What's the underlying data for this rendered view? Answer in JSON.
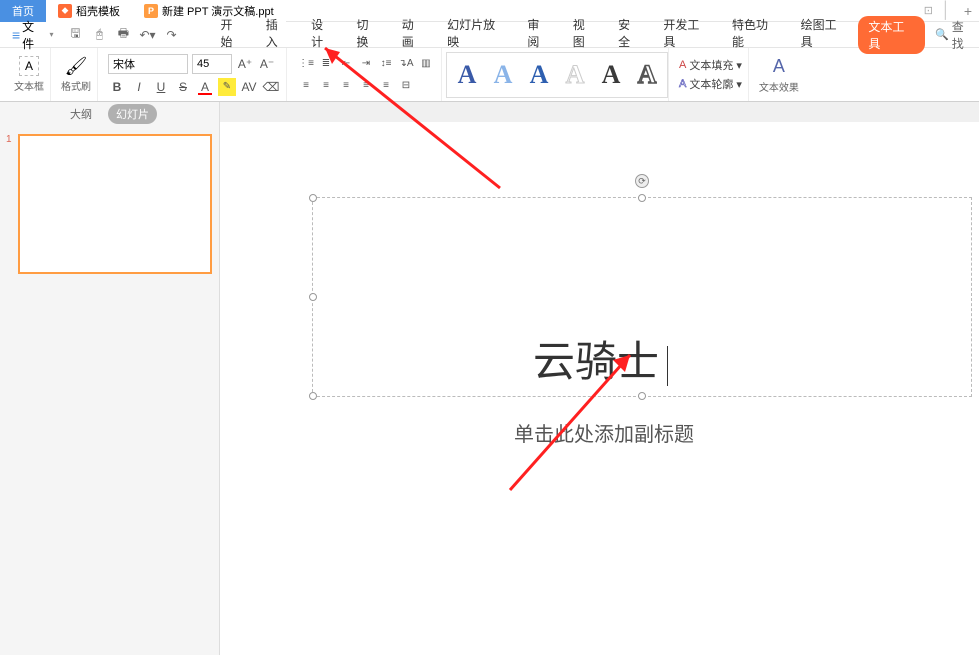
{
  "tabs": {
    "home": "首页",
    "template": "稻壳模板",
    "active": "新建 PPT 演示文稿.ppt"
  },
  "file_menu": "文件",
  "menu": {
    "start": "开始",
    "insert": "插入",
    "design": "设计",
    "transition": "切换",
    "animation": "动画",
    "slideshow": "幻灯片放映",
    "review": "审阅",
    "view": "视图",
    "security": "安全",
    "devtools": "开发工具",
    "features": "特色功能",
    "drawing": "绘图工具",
    "texttools": "文本工具"
  },
  "search": "查找",
  "ribbon": {
    "textbox": "文本框",
    "format_painter": "格式刷",
    "font_name": "宋体",
    "font_size": "45",
    "text_fill": "文本填充",
    "text_outline": "文本轮廓",
    "text_effects": "文本效果"
  },
  "wordart_styles": [
    {
      "color": "#3a5aa8"
    },
    {
      "color": "#8ab4e8"
    },
    {
      "color": "#2e5fb0"
    },
    {
      "color": "#e8e0c0"
    },
    {
      "color": "#3a3a3a"
    },
    {
      "color": "#888"
    }
  ],
  "panel": {
    "outline": "大纲",
    "slides": "幻灯片",
    "thumb_num": "1"
  },
  "slide": {
    "title": "云骑士",
    "subtitle_placeholder": "单击此处添加副标题"
  }
}
